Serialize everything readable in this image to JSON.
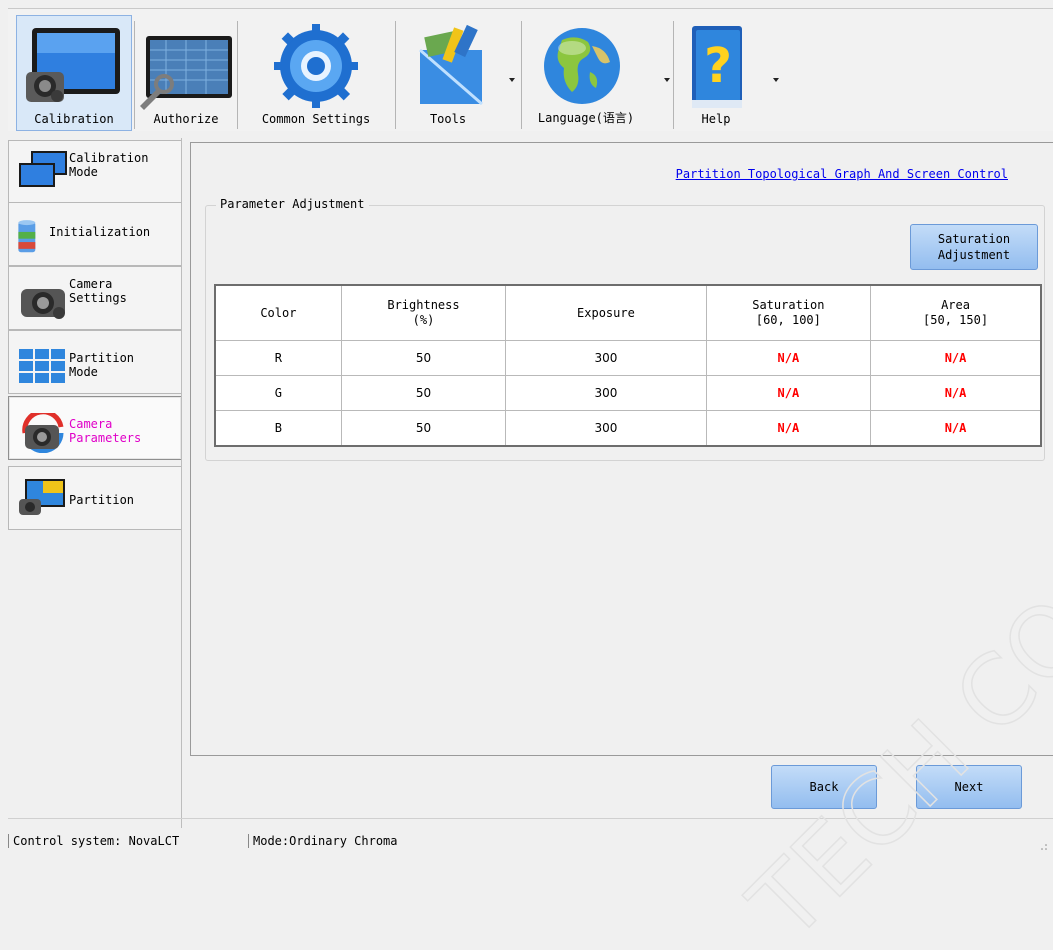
{
  "toolbar": {
    "items": [
      {
        "label": "Calibration",
        "icon": "calibration-camera-monitor-icon",
        "active": true
      },
      {
        "label": "Authorize",
        "icon": "authorize-monitor-wrench-icon"
      },
      {
        "label": "Common Settings",
        "icon": "gear-icon"
      },
      {
        "label": "Tools",
        "icon": "tools-icon",
        "has_dropdown": true
      },
      {
        "label": "Language(语言)",
        "icon": "globe-icon",
        "has_dropdown": true
      },
      {
        "label": "Help",
        "icon": "help-book-icon",
        "has_dropdown": true
      }
    ]
  },
  "sidebar": {
    "items": [
      {
        "label": "Calibration\nMode",
        "icon": "calibration-mode-screens-icon"
      },
      {
        "label": "Initialization",
        "icon": "initialization-cylinder-icon"
      },
      {
        "label": "Camera\nSettings",
        "icon": "camera-settings-icon"
      },
      {
        "label": "Partition\nMode",
        "icon": "partition-grid-icon"
      },
      {
        "label": "Camera\nParameters",
        "icon": "camera-parameters-icon",
        "active": true
      },
      {
        "label": "Partition",
        "icon": "partition-screen-icon"
      }
    ]
  },
  "main": {
    "top_link": "Partition Topological Graph And Screen Control",
    "group_title": "Parameter Adjustment",
    "saturation_button": "Saturation\nAdjustment",
    "table": {
      "headers": [
        "Color",
        "Brightness\n(%)",
        "Exposure",
        "Saturation\n[60, 100]",
        "Area\n[50, 150]"
      ],
      "rows": [
        [
          "R",
          "50",
          "300",
          "N/A",
          "N/A"
        ],
        [
          "G",
          "50",
          "300",
          "N/A",
          "N/A"
        ],
        [
          "B",
          "50",
          "300",
          "N/A",
          "N/A"
        ]
      ]
    },
    "back_button": "Back",
    "next_button": "Next"
  },
  "status": {
    "control_system": "Control system: NovaLCT",
    "mode": "Mode:Ordinary Chroma"
  },
  "watermark": "TECH CO.,LTD",
  "colors": {
    "accent_blue": "#93bdef",
    "active_pink": "#e000c8",
    "na_red": "#ff0000",
    "link_blue": "#0000ee"
  }
}
